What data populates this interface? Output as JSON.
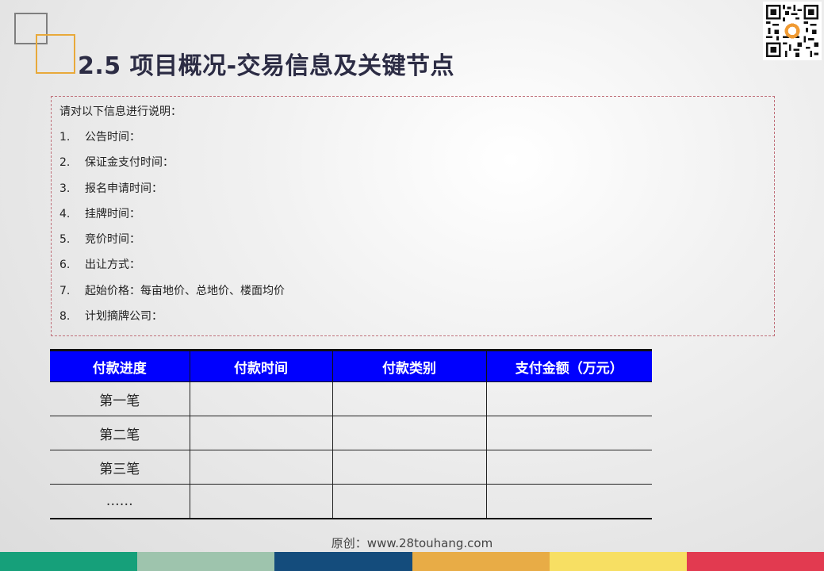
{
  "title": "2.5 项目概况-交易信息及关键节点",
  "info": {
    "intro": "请对以下信息进行说明：",
    "items": [
      {
        "num": "1.",
        "text": "公告时间："
      },
      {
        "num": "2.",
        "text": "保证金支付时间："
      },
      {
        "num": "3.",
        "text": "报名申请时间："
      },
      {
        "num": "4.",
        "text": "挂牌时间："
      },
      {
        "num": "5.",
        "text": "竞价时间："
      },
      {
        "num": "6.",
        "text": "出让方式："
      },
      {
        "num": "7.",
        "text": "起始价格：每亩地价、总地价、楼面均价"
      },
      {
        "num": "8.",
        "text": "计划摘牌公司："
      }
    ]
  },
  "table": {
    "headers": [
      "付款进度",
      "付款时间",
      "付款类别",
      "支付金额（万元）"
    ],
    "rows": [
      [
        "第一笔",
        "",
        "",
        ""
      ],
      [
        "第二笔",
        "",
        "",
        ""
      ],
      [
        "第三笔",
        "",
        "",
        ""
      ],
      [
        "……",
        "",
        "",
        ""
      ]
    ]
  },
  "footer": {
    "credit": "原创：www.28touhang.com",
    "bar_colors": [
      "#16a07a",
      "#9ec4ad",
      "#144c7c",
      "#e8ac46",
      "#f7df63",
      "#e23a50"
    ]
  },
  "colors": {
    "title": "#2c2c44",
    "table_header": "#0000fe",
    "box_border": "#c0707a"
  },
  "icons": {
    "qr": "qr-code-icon"
  }
}
